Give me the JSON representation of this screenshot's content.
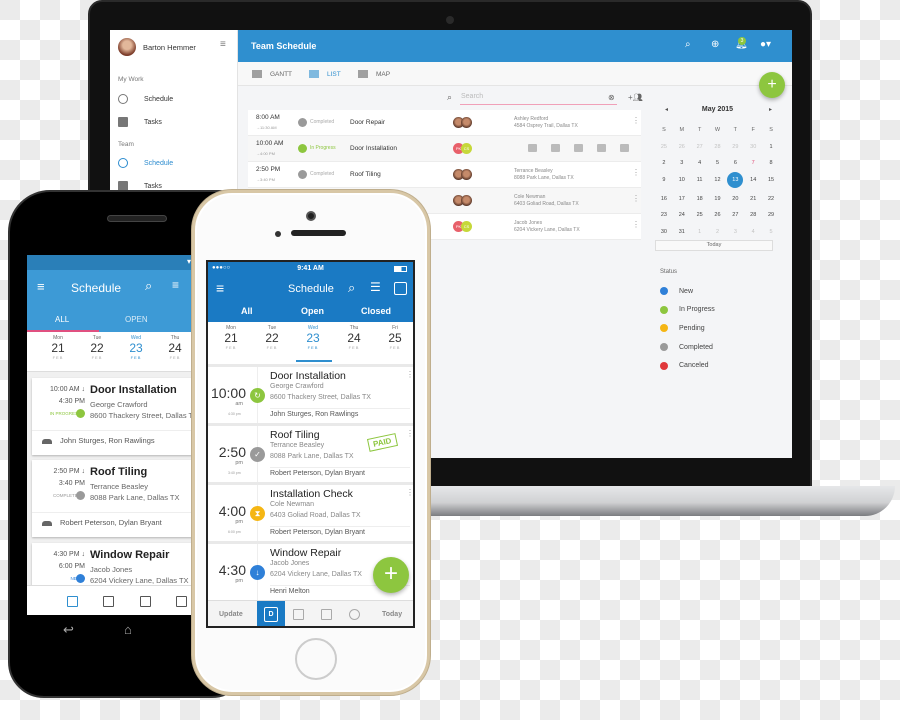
{
  "laptop": {
    "sidebar": {
      "user_name": "Barton Hemmer",
      "sections": [
        {
          "title": "My Work",
          "items": [
            {
              "label": "Schedule",
              "icon": "clock-icon"
            },
            {
              "label": "Tasks",
              "icon": "task-icon"
            }
          ]
        },
        {
          "title": "Team",
          "items": [
            {
              "label": "Schedule",
              "icon": "clock-icon",
              "active": true
            },
            {
              "label": "Tasks",
              "icon": "task-icon"
            }
          ]
        }
      ]
    },
    "header": {
      "title": "Team Schedule",
      "notification_count": "3"
    },
    "views": [
      {
        "label": "GANTT"
      },
      {
        "label": "LIST",
        "active": true
      },
      {
        "label": "MAP"
      }
    ],
    "search": {
      "placeholder": "Search"
    },
    "rows": [
      {
        "start": "8:00 AM",
        "end": "→11:30 AM",
        "status": "Completed",
        "title": "Door Repair",
        "assignees": [
          "",
          ""
        ],
        "client": "Ashley Redford",
        "address": "4584 Osprey Trail, Dallas TX"
      },
      {
        "start": "10:00 AM",
        "end": "→4:00 PM",
        "status": "In Progress",
        "title": "Door Installation",
        "assignees": [
          "PK",
          "CS"
        ],
        "client": "",
        "address": ""
      },
      {
        "start": "2:50 PM",
        "end": "→3:40 PM",
        "status": "Completed",
        "title": "Roof Tiling",
        "assignees": [
          "",
          ""
        ],
        "client": "Terrance Beasley",
        "address": "8088 Park Lane, Dallas TX"
      },
      {
        "start": "",
        "end": "",
        "status": "",
        "title": "",
        "assignees": [
          "",
          ""
        ],
        "client": "Cole Newman",
        "address": "6403 Goliad Road, Dallas TX"
      },
      {
        "start": "",
        "end": "",
        "status": "",
        "title": "",
        "assignees": [
          "PK",
          "CS"
        ],
        "client": "Jacob Jones",
        "address": "6204 Vickery Lane, Dallas TX"
      }
    ],
    "calendar": {
      "month": "May 2015",
      "weekdays": [
        "S",
        "M",
        "T",
        "W",
        "T",
        "F",
        "S"
      ],
      "days": [
        "25",
        "26",
        "27",
        "28",
        "29",
        "30",
        "1",
        "2",
        "3",
        "4",
        "5",
        "6",
        "7",
        "8",
        "9",
        "10",
        "11",
        "12",
        "13",
        "14",
        "15",
        "16",
        "17",
        "18",
        "19",
        "20",
        "21",
        "22",
        "23",
        "24",
        "25",
        "26",
        "27",
        "28",
        "29",
        "30",
        "31",
        "1",
        "2",
        "3",
        "4",
        "5"
      ],
      "selected": "13",
      "today_label": "Today"
    },
    "status_legend": {
      "title": "Status",
      "items": [
        {
          "label": "New",
          "color": "#2f80d8"
        },
        {
          "label": "In Progress",
          "color": "#8dc63f"
        },
        {
          "label": "Pending",
          "color": "#f5b614"
        },
        {
          "label": "Completed",
          "color": "#9a9a9a"
        },
        {
          "label": "Canceled",
          "color": "#e0383b"
        }
      ]
    }
  },
  "android": {
    "title": "Schedule",
    "tabs": [
      "ALL",
      "OPEN"
    ],
    "dates": [
      {
        "dow": "Mon",
        "day": "21",
        "mon": "FEB"
      },
      {
        "dow": "Tue",
        "day": "22",
        "mon": "FEB"
      },
      {
        "dow": "Wed",
        "day": "23",
        "mon": "FEB",
        "active": true
      },
      {
        "dow": "Thu",
        "day": "24",
        "mon": "FEB"
      }
    ],
    "cards": [
      {
        "start": "10:00 AM ↓",
        "end": "4:30 PM",
        "status": "IN PROGRESS",
        "status_color": "#8dc63f",
        "title": "Door Installation",
        "client": "George Crawford",
        "address": "8600 Thackery Street, Dallas TX",
        "crew": "John Sturges, Ron Rawlings"
      },
      {
        "start": "2:50 PM ↓",
        "end": "3:40 PM",
        "status": "COMPLETED",
        "status_color": "#9a9a9a",
        "title": "Roof Tiling",
        "client": "Terrance Beasley",
        "address": "8088 Park Lane, Dallas TX",
        "crew": "Robert Peterson, Dylan Bryant"
      },
      {
        "start": "4:30 PM ↓",
        "end": "6:00 PM",
        "status": "NEW",
        "status_color": "#2f80d8",
        "title": "Window Repair",
        "client": "Jacob Jones",
        "address": "6204 Vickery Lane, Dallas TX",
        "crew": ""
      }
    ]
  },
  "iphone": {
    "time": "9:41 AM",
    "title": "Schedule",
    "tabs": [
      "All",
      "Open",
      "Closed"
    ],
    "dates": [
      {
        "dow": "Mon",
        "day": "21",
        "mon": "FEB"
      },
      {
        "dow": "Tue",
        "day": "22",
        "mon": "FEB"
      },
      {
        "dow": "Wed",
        "day": "23",
        "mon": "FEB",
        "active": true
      },
      {
        "dow": "Thu",
        "day": "24",
        "mon": "FEB"
      },
      {
        "dow": "Fri",
        "day": "25",
        "mon": "FEB"
      }
    ],
    "cards": [
      {
        "time": "10:00",
        "ampm": "am",
        "end": "4:30 pm",
        "status_color": "#8dc63f",
        "title": "Door Installation",
        "client": "George Crawford",
        "address": "8600 Thackery Street, Dallas TX",
        "crew": "John Sturges, Ron Rawlings"
      },
      {
        "time": "2:50",
        "ampm": "pm",
        "end": "3:40 pm",
        "status_color": "#9a9a9a",
        "title": "Roof Tiling",
        "client": "Terrance Beasley",
        "address": "8088 Park Lane, Dallas TX",
        "crew": "Robert Peterson, Dylan Bryant",
        "badge": "PAID"
      },
      {
        "time": "4:00",
        "ampm": "pm",
        "end": "6:00 pm",
        "status_color": "#f5b614",
        "title": "Installation Check",
        "client": "Cole Newman",
        "address": "6403 Goliad Road, Dallas TX",
        "crew": "Robert Peterson, Dylan Bryant"
      },
      {
        "time": "4:30",
        "ampm": "pm",
        "end": "",
        "status_color": "#2f80d8",
        "title": "Window Repair",
        "client": "Jacob Jones",
        "address": "6204 Vickery Lane, Dallas TX",
        "crew": "Henri Melton"
      }
    ],
    "bottom": {
      "update_label": "Update",
      "today_label": "Today",
      "day_icon_letter": "D"
    }
  }
}
